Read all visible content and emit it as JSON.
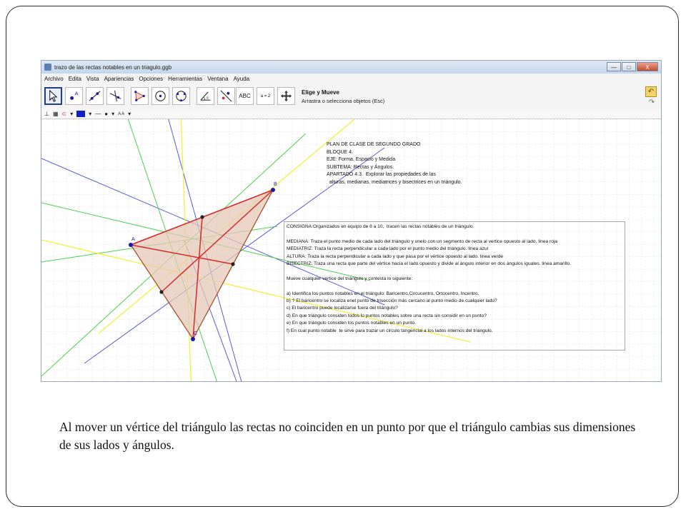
{
  "window": {
    "title": "trazo de las rectas notables en un triagulo.ggb",
    "minimize": "—",
    "maximize": "□",
    "close": "X"
  },
  "menu": [
    "Archivo",
    "Edita",
    "Vista",
    "Apariencias",
    "Opciones",
    "Herramientas",
    "Ventana",
    "Ayuda"
  ],
  "toolbar": {
    "tool_title": "Elige y Mueve",
    "tool_desc": "Arrastra o selecciona objetos (Esc)",
    "text_tool": "ABC",
    "slider_tool": "a = 2",
    "undo": "↶",
    "redo": "↷"
  },
  "stylebar": {
    "font_size": "A A"
  },
  "points": {
    "a": "A",
    "b": "B",
    "c": "C"
  },
  "plan": [
    "PLAN DE CLASE DE SEGUNDO GRADO",
    "BLOQUE 4.",
    "EJE: Forma, Espacio y Medida",
    "SUBTEMA: Rectas y Ángulos.",
    "APARTADO 4.3.  Explorar las propiedades de las",
    "  alturas, medianas, mediatrices y bisectrices en un triángulo."
  ],
  "consigna": [
    "CONSIGNA:Organizados en equipo de 8 a 10,  tracen las rectas notables de un triángulo.",
    "",
    "MEDIANA: Traza el punto medio de cada lado del triángulo y unelo con un segmento de recta al vertice opuesto al lado. linea roja",
    "MEDIATRIZ: Traza la recta perpendicular a cada lado por el punto medio del triángulo. linea azul",
    "ALTURA: Traza la recta perpendicular a cada lado y que pasa por el vértice opuesto al lado. linea verde",
    "BISECTRIZ: Traza una recta que parte del vértice hacia el lado opuesto y divide al ángulo interior en dos ángulos iguales. linea amarillo.",
    "",
    "Mueve cualquier vertice del triángulo y contesta lo siguiente:",
    "",
    "a) Identifica los puntos notables en el triángulo: Baricentro,Circucentro, Ortocentro, Incentro.",
    "b) ? El baricentro se localiza enel punto de trisección más cercano al punto medio de cualquier lado?",
    "c) El baricentro puede localizarse fuera del triángulo?",
    "d) En que triángulo considen todos lo puntos notables sobre una recta sin considir en un punto?",
    "e) En que triángulo considen los puntos notables en un punto.",
    "f) En cual punto notable  te sirve para trazar un circulo tangencial a los lados internos del triángulo."
  ],
  "caption": "Al mover un vértice  del triángulo las rectas no coinciden en un punto por que el triángulo cambias sus dimensiones de sus lados y ángulos.",
  "colors": {
    "mediana": "#d62a2a",
    "mediatriz": "#5a5ad8",
    "altura": "#4cd04c",
    "bisectriz": "#f2f23c",
    "triangle_fill": "#e6c8b8",
    "triangle_stroke": "#a0522d",
    "point": "#1a1aa8"
  }
}
